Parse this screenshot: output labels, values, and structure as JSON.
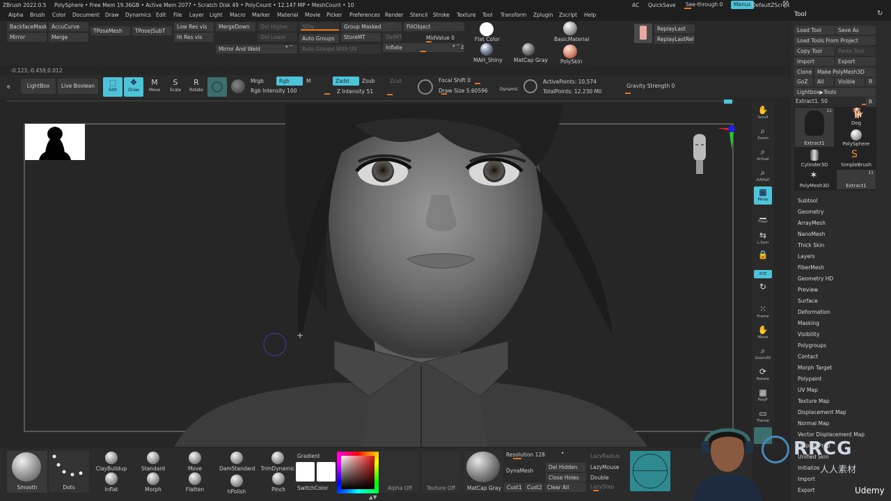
{
  "title_bar": {
    "app": "ZBrush 2022.0.5",
    "tool": "PolySphere",
    "stats": "• Free Mem 19.36GB • Active Mem 2077 • Scratch Disk 49 • PolyCount • 12.147 MP • MeshCount • 10",
    "ac": "AC",
    "quicksave": "QuickSave",
    "seethrough": "See-through  0",
    "menus": "Menus",
    "defaultzscript": "DefaultZScript"
  },
  "menu": [
    "Alpha",
    "Brush",
    "Color",
    "Document",
    "Draw",
    "Dynamics",
    "Edit",
    "File",
    "Layer",
    "Light",
    "Macro",
    "Marker",
    "Material",
    "Movie",
    "Picker",
    "Preferences",
    "Render",
    "Stencil",
    "Stroke",
    "Texture",
    "Tool",
    "Transform",
    "Zplugin",
    "Zscript",
    "Help"
  ],
  "shelf": {
    "backfacemask": "BackfaceMask",
    "accucurve": "AccuCurve",
    "mirror": "Mirror",
    "merge": "Merge",
    "tposemesh": "TPoseMesh",
    "tposesubt": "TPose|SubT",
    "lowresvis": "Low Res vis",
    "hiresvis": "Hi Res vis",
    "mergedown": "MergeDown",
    "delhigher": "Del Higher",
    "dellower": "Del Lower",
    "sdiv": "SDiv",
    "mirrorandweld": "Mirror And Weld",
    "groupmasked": "Group Masked",
    "autogroups": "Auto Groups",
    "storemt": "StoreMT",
    "delmt": "DelMT",
    "autogroupsuv": "Auto Groups With UV",
    "fillobject": "FillObject",
    "midvalue": "MidValue 0",
    "inflate": "Inflate",
    "flatcolor": "Flat Color",
    "basicmaterial": "BasicMaterial",
    "mahshiny": "MAH_Shiny",
    "matcapgray": "MatCap Gray",
    "polyskin": "PolySkin",
    "replaylast": "ReplayLast",
    "replaylastrel": "ReplayLastRel"
  },
  "coords": "-0.123,-0.459,0.012",
  "toolbar2": {
    "e": "e",
    "lightbox": "LightBox",
    "liveboolean": "Live Boolean",
    "edit": "Edit",
    "draw": "Draw",
    "move": "Move",
    "scale": "Scale",
    "rotate": "Rotate",
    "mrgb": "Mrgb",
    "rgb": "Rgb",
    "m": "M",
    "rgbintensity": "Rgb Intensity 100",
    "zadd": "Zadd",
    "zsub": "Zsub",
    "zcut": "Zcut",
    "zintensity": "Z Intensity 51",
    "focalshift": "Focal Shift 0",
    "drawsize": "Draw Size 5.60596",
    "dynamic": "Dynamic",
    "activepoints": "ActivePoints: 10,574",
    "totalpoints": "TotalPoints: 12.230 Mil",
    "gravity": "Gravity Strength 0"
  },
  "right_icons": [
    "Scroll",
    "Zoom",
    "Actual",
    "AAHalf",
    "Persp",
    "Floor",
    "L.Sym",
    "",
    "XYZ",
    "",
    "Frame",
    "Move",
    "Zoom3D",
    "Rotate",
    "PolyF",
    "Transp"
  ],
  "tool_panel": {
    "title": "Tool",
    "buttons": {
      "load_tool": "Load Tool",
      "save_as": "Save As",
      "load_from_project": "Load Tools From Project",
      "copy_tool": "Copy Tool",
      "paste_tool": "Paste Tool",
      "import": "Import",
      "export": "Export",
      "clone": "Clone",
      "make_polymesh": "Make PolyMesh3D",
      "goz": "GoZ",
      "all": "All",
      "visible": "Visible",
      "r": "R",
      "lightbox_tools": "Lightbox▶Tools",
      "extract_slider": "Extract1. 50"
    },
    "thumbs": [
      {
        "label": "Extract1",
        "count": "11"
      },
      {
        "label": "Dog",
        "count": ""
      },
      {
        "label": "PolySphere",
        "count": ""
      },
      {
        "label": "Cylinder3D",
        "count": ""
      },
      {
        "label": "SimpleBrush",
        "count": ""
      },
      {
        "label": "PolyMesh3D",
        "count": ""
      },
      {
        "label": "Extract1",
        "count": "11"
      }
    ],
    "subpalettes": [
      "Subtool",
      "Geometry",
      "ArrayMesh",
      "NanoMesh",
      "Thick Skin",
      "Layers",
      "FiberMesh",
      "Geometry HD",
      "Preview",
      "Surface",
      "Deformation",
      "Masking",
      "Visibility",
      "Polygroups",
      "Contact",
      "Morph Target",
      "Polypaint",
      "UV Map",
      "Texture Map",
      "Displacement Map",
      "Normal Map",
      "Vector Displacement Map",
      "Display Prop",
      "Unified Skin",
      "Initialize",
      "Import",
      "Export"
    ]
  },
  "bottom": {
    "brushes": [
      {
        "label": "ClayBuildup"
      },
      {
        "label": "Standard"
      },
      {
        "label": "Move"
      },
      {
        "label": "DamStandard"
      },
      {
        "label": "TrimDynamic"
      },
      {
        "label": "Inflat"
      },
      {
        "label": "Morph"
      },
      {
        "label": "Flatten"
      },
      {
        "label": "hPolish"
      },
      {
        "label": "Pinch"
      }
    ],
    "smooth": "Smooth",
    "dots": "Dots",
    "gradient": "Gradient",
    "switchcolor": "SwitchColor",
    "alphaoff": "Alpha Off",
    "textureoff": "Texture Off",
    "matcapgray": "MatCap Gray",
    "resolution": "Resolution 128",
    "dynamesh": "DynaMesh",
    "delhidden": "Del Hidden",
    "closeholes": "Close Holes",
    "cust1": "Cust1",
    "cust2": "Cust2",
    "clearall": "Clear All",
    "lazyradius": "LazyRadius",
    "lazymouse": "LazyMouse",
    "double": "Double",
    "lazystep": "LazyStep"
  },
  "watermark": {
    "brand": "RRCG",
    "sub": "人人素材",
    "udemy": "Udemy"
  },
  "colors": {
    "accent": "#4fc3d8",
    "orange": "#e07a2a",
    "panel": "#2b2b2b",
    "canvas": "#262626"
  }
}
